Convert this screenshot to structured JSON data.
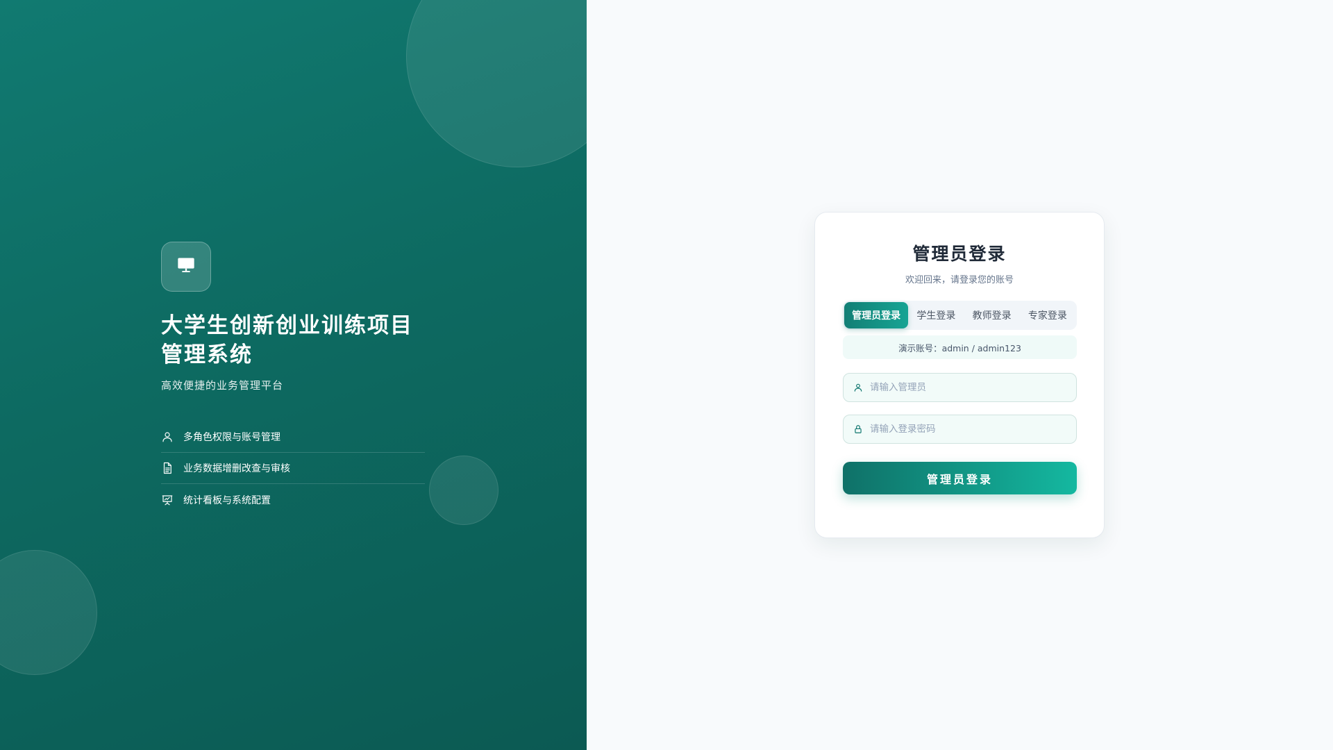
{
  "hero": {
    "logo_icon": "monitor-icon",
    "title": "大学生创新创业训练项目管理系统",
    "subtitle": "高效便捷的业务管理平台",
    "features": [
      {
        "icon": "user-icon",
        "label": "多角色权限与账号管理"
      },
      {
        "icon": "document-icon",
        "label": "业务数据增删改查与审核"
      },
      {
        "icon": "presentation-chart-icon",
        "label": "统计看板与系统配置"
      }
    ]
  },
  "login": {
    "title": "管理员登录",
    "subtitle": "欢迎回来，请登录您的账号",
    "tabs": [
      {
        "label": "管理员登录",
        "active": true
      },
      {
        "label": "学生登录",
        "active": false
      },
      {
        "label": "教师登录",
        "active": false
      },
      {
        "label": "专家登录",
        "active": false
      }
    ],
    "demo_hint": "演示账号：admin / admin123",
    "username": {
      "value": "",
      "placeholder": "请输入管理员",
      "icon": "user-icon"
    },
    "password": {
      "value": "",
      "placeholder": "请输入登录密码",
      "icon": "lock-icon"
    },
    "submit_label": "管理员登录"
  },
  "colors": {
    "brand_dark": "#0f7168",
    "brand_light": "#14b8a0",
    "hero_bg": "#0d6a61"
  }
}
